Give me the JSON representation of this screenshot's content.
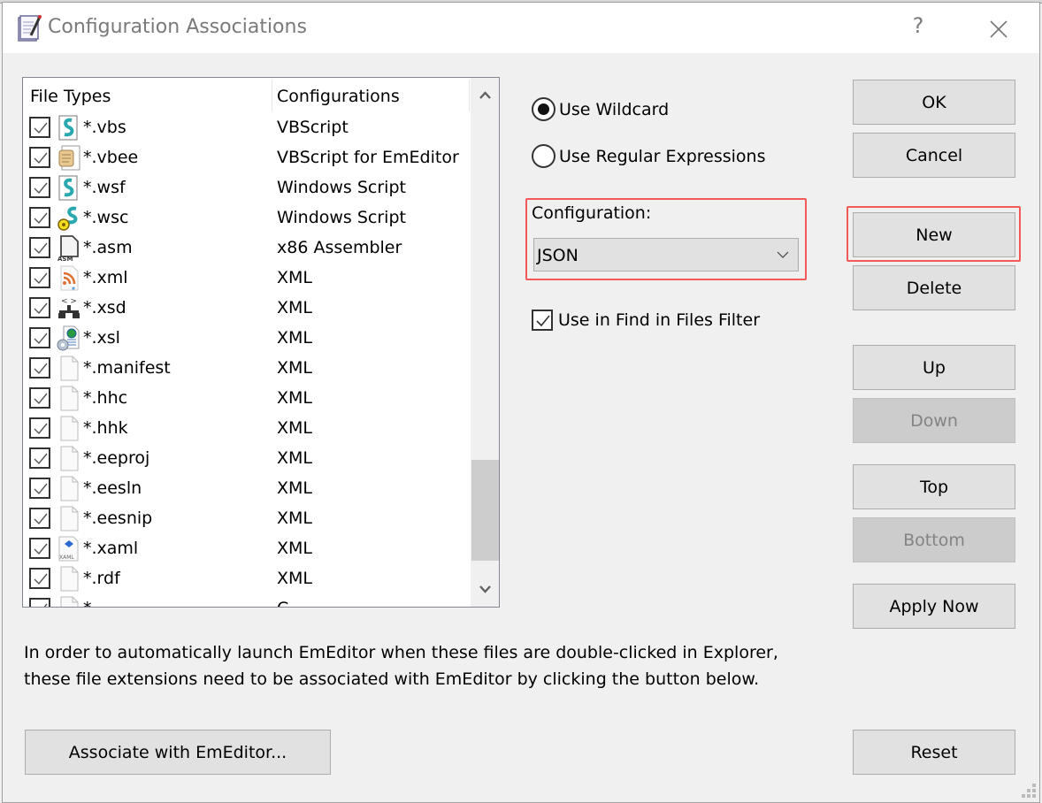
{
  "window": {
    "title": "Configuration Associations",
    "help_label": "?",
    "icons": {
      "app": "notepad-pencil-icon",
      "close": "close-x-icon"
    }
  },
  "list": {
    "columns": [
      "File Types",
      "Configurations"
    ],
    "rows": [
      {
        "checked": true,
        "icon": "vbscript-file-icon",
        "type": "*.vbs",
        "config": "VBScript"
      },
      {
        "checked": true,
        "icon": "scroll-file-icon",
        "type": "*.vbee",
        "config": "VBScript for EmEditor"
      },
      {
        "checked": true,
        "icon": "vbscript-file-icon",
        "type": "*.wsf",
        "config": "Windows Script"
      },
      {
        "checked": true,
        "icon": "script-gear-icon",
        "type": "*.wsc",
        "config": "Windows Script"
      },
      {
        "checked": true,
        "icon": "asm-file-icon",
        "type": "*.asm",
        "config": "x86 Assembler"
      },
      {
        "checked": true,
        "icon": "rss-file-icon",
        "type": "*.xml",
        "config": "XML"
      },
      {
        "checked": true,
        "icon": "schema-tree-icon",
        "type": "*.xsd",
        "config": "XML"
      },
      {
        "checked": true,
        "icon": "xsl-globe-icon",
        "type": "*.xsl",
        "config": "XML"
      },
      {
        "checked": true,
        "icon": "blank-file-icon",
        "type": "*.manifest",
        "config": "XML"
      },
      {
        "checked": true,
        "icon": "blank-file-icon",
        "type": "*.hhc",
        "config": "XML"
      },
      {
        "checked": true,
        "icon": "blank-file-icon",
        "type": "*.hhk",
        "config": "XML"
      },
      {
        "checked": true,
        "icon": "blank-file-icon",
        "type": "*.eeproj",
        "config": "XML"
      },
      {
        "checked": true,
        "icon": "blank-file-icon",
        "type": "*.eesln",
        "config": "XML"
      },
      {
        "checked": true,
        "icon": "blank-file-icon",
        "type": "*.eesnip",
        "config": "XML"
      },
      {
        "checked": true,
        "icon": "xaml-file-icon",
        "type": "*.xaml",
        "config": "XML"
      },
      {
        "checked": true,
        "icon": "blank-file-icon",
        "type": "*.rdf",
        "config": "XML"
      },
      {
        "checked": true,
        "icon": "blank-file-icon",
        "type": "*.",
        "config": "C"
      }
    ],
    "scroll_position": 0.85
  },
  "options": {
    "use_wildcard": "Use Wildcard",
    "use_regex": "Use Regular Expressions",
    "selected_mode": "wildcard",
    "configuration_label": "Configuration:",
    "configuration_value": "JSON",
    "find_filter_label": "Use in Find in Files Filter",
    "find_filter_checked": true
  },
  "buttons": {
    "ok": "OK",
    "cancel": "Cancel",
    "new": "New",
    "delete": "Delete",
    "up": "Up",
    "down": "Down",
    "top": "Top",
    "bottom": "Bottom",
    "apply_now": "Apply Now",
    "reset": "Reset",
    "associate": "Associate with EmEditor..."
  },
  "info": {
    "line1": "In order to automatically launch EmEditor when these files are double-clicked in Explorer,",
    "line2": "these file extensions need to be associated with EmEditor by clicking the button below."
  },
  "colors": {
    "highlight": "#f25a5a",
    "button_bg": "#e1e1e1",
    "disabled_bg": "#cccccc",
    "dialog_bg": "#f0f0f0"
  }
}
